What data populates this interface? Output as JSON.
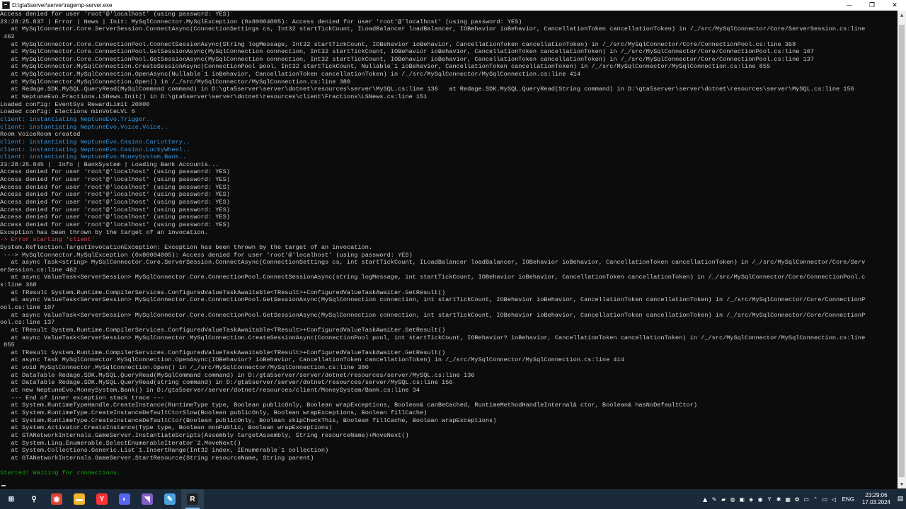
{
  "window": {
    "title": "D:\\gta5server\\server\\ragemp-server.exe",
    "minimize_label": "—",
    "maximize_label": "❐",
    "close_label": "✕"
  },
  "console": {
    "lines": [
      {
        "t": "Access denied for user 'root'@'localhost' (using password: YES)",
        "c": ""
      },
      {
        "t": "23:28:25.837 | Error | News | Init: MySqlConnector.MySqlException (0x80004005): Access denied for user 'root'@'localhost' (using password: YES)",
        "c": ""
      },
      {
        "t": "   at MySqlConnector.Core.ServerSession.ConnectAsync(ConnectionSettings cs, Int32 startTickCount, ILoadBalancer loadBalancer, IOBehavior ioBehavior, CancellationToken cancellationToken) in /_/src/MySqlConnector/Core/ServerSession.cs:line",
        "c": ""
      },
      {
        "t": " 462",
        "c": ""
      },
      {
        "t": "   at MySqlConnector.Core.ConnectionPool.ConnectSessionAsync(String logMessage, Int32 startTickCount, IOBehavior ioBehavior, CancellationToken cancellationToken) in /_/src/MySqlConnector/Core/ConnectionPool.cs:line 368",
        "c": ""
      },
      {
        "t": "   at MySqlConnector.Core.ConnectionPool.GetSessionAsync(MySqlConnection connection, Int32 startTickCount, IOBehavior ioBehavior, CancellationToken cancellationToken) in /_/src/MySqlConnector/Core/ConnectionPool.cs:line 107",
        "c": ""
      },
      {
        "t": "   at MySqlConnector.Core.ConnectionPool.GetSessionAsync(MySqlConnection connection, Int32 startTickCount, IOBehavior ioBehavior, CancellationToken cancellationToken) in /_/src/MySqlConnector/Core/ConnectionPool.cs:line 137",
        "c": ""
      },
      {
        "t": "   at MySqlConnector.MySqlConnection.CreateSessionAsync(ConnectionPool pool, Int32 startTickCount, Nullable`1 ioBehavior, CancellationToken cancellationToken) in /_/src/MySqlConnector/MySqlConnection.cs:line 855",
        "c": ""
      },
      {
        "t": "   at MySqlConnector.MySqlConnection.OpenAsync(Nullable`1 ioBehavior, CancellationToken cancellationToken) in /_/src/MySqlConnector/MySqlConnection.cs:line 414",
        "c": ""
      },
      {
        "t": "   at MySqlConnector.MySqlConnection.Open() in /_/src/MySqlConnector/MySqlConnection.cs:line 380",
        "c": ""
      },
      {
        "t": "   at Redage.SDK.MySQL.QueryRead(MySqlCommand command) in D:\\gta5server\\server\\dotnet\\resources\\server\\MySQL.cs:line 136   at Redage.SDK.MySQL.QueryRead(String command) in D:\\gta5server\\server\\dotnet\\resources\\server\\MySQL.cs:line 156",
        "c": ""
      },
      {
        "t": "   at NeptuneEvo.Fractions.LSNews.Init() in D:\\gta5server\\server\\dotnet\\resources\\client\\Fractions\\LSNews.cs:line 151",
        "c": ""
      },
      {
        "t": "Loaded config: EventSys RewardLimit 20000",
        "c": ""
      },
      {
        "t": "Loaded config: Elections minVoteLVL 5",
        "c": ""
      },
      {
        "t": "client: instantiating NeptuneEvo.Trigger..",
        "c": "cyan"
      },
      {
        "t": "client: instantiating NeptuneEvo.Voice.Voice..",
        "c": "cyan"
      },
      {
        "t": "Room VoiceRoom created",
        "c": ""
      },
      {
        "t": "client: instantiating NeptuneEvo.Casino.CarLottery..",
        "c": "cyan"
      },
      {
        "t": "client: instantiating NeptuneEvo.Casino.LuckyWheel..",
        "c": "cyan"
      },
      {
        "t": "client: instantiating NeptuneEvo.MoneySystem.Bank..",
        "c": "cyan"
      },
      {
        "t": "23:28:25.845 |  Info | BankSystem | Loading Bank Accounts...",
        "c": ""
      },
      {
        "t": "Access denied for user 'root'@'localhost' (using password: YES)",
        "c": ""
      },
      {
        "t": "Access denied for user 'root'@'localhost' (using password: YES)",
        "c": ""
      },
      {
        "t": "Access denied for user 'root'@'localhost' (using password: YES)",
        "c": ""
      },
      {
        "t": "Access denied for user 'root'@'localhost' (using password: YES)",
        "c": ""
      },
      {
        "t": "Access denied for user 'root'@'localhost' (using password: YES)",
        "c": ""
      },
      {
        "t": "Access denied for user 'root'@'localhost' (using password: YES)",
        "c": ""
      },
      {
        "t": "Access denied for user 'root'@'localhost' (using password: YES)",
        "c": ""
      },
      {
        "t": "Access denied for user 'root'@'localhost' (using password: YES)",
        "c": ""
      },
      {
        "t": "Exception has been thrown by the target of an invocation.",
        "c": ""
      },
      {
        "t": "-> Error starting 'client'",
        "c": "red"
      },
      {
        "t": "System.Reflection.TargetInvocationException: Exception has been thrown by the target of an invocation.",
        "c": ""
      },
      {
        "t": " ---> MySqlConnector.MySqlException (0x80004005): Access denied for user 'root'@'localhost' (using password: YES)",
        "c": ""
      },
      {
        "t": "   at async Task<string> MySqlConnector.Core.ServerSession.ConnectAsync(ConnectionSettings cs, int startTickCount, ILoadBalancer loadBalancer, IOBehavior ioBehavior, CancellationToken cancellationToken) in /_/src/MySqlConnector/Core/Serv",
        "c": ""
      },
      {
        "t": "erSession.cs:line 462",
        "c": ""
      },
      {
        "t": "   at async ValueTask<ServerSession> MySqlConnector.Core.ConnectionPool.ConnectSessionAsync(string logMessage, int startTickCount, IOBehavior ioBehavior, CancellationToken cancellationToken) in /_/src/MySqlConnector/Core/ConnectionPool.c",
        "c": ""
      },
      {
        "t": "s:line 368",
        "c": ""
      },
      {
        "t": "   at TResult System.Runtime.CompilerServices.ConfiguredValueTaskAwaitable<TResult>+ConfiguredValueTaskAwaiter.GetResult()",
        "c": ""
      },
      {
        "t": "   at async ValueTask<ServerSession> MySqlConnector.Core.ConnectionPool.GetSessionAsync(MySqlConnection connection, int startTickCount, IOBehavior ioBehavior, CancellationToken cancellationToken) in /_/src/MySqlConnector/Core/ConnectionP",
        "c": ""
      },
      {
        "t": "ool.cs:line 107",
        "c": ""
      },
      {
        "t": "   at async ValueTask<ServerSession> MySqlConnector.Core.ConnectionPool.GetSessionAsync(MySqlConnection connection, int startTickCount, IOBehavior ioBehavior, CancellationToken cancellationToken) in /_/src/MySqlConnector/Core/ConnectionP",
        "c": ""
      },
      {
        "t": "ool.cs:line 137",
        "c": ""
      },
      {
        "t": "   at TResult System.Runtime.CompilerServices.ConfiguredValueTaskAwaitable<TResult>+ConfiguredValueTaskAwaiter.GetResult()",
        "c": ""
      },
      {
        "t": "   at async ValueTask<ServerSession> MySqlConnector.MySqlConnection.CreateSessionAsync(ConnectionPool pool, int startTickCount, IOBehavior? ioBehavior, CancellationToken cancellationToken) in /_/src/MySqlConnector/MySqlConnection.cs:line",
        "c": ""
      },
      {
        "t": " 855",
        "c": ""
      },
      {
        "t": "   at TResult System.Runtime.CompilerServices.ConfiguredValueTaskAwaitable<TResult>+ConfiguredValueTaskAwaiter.GetResult()",
        "c": ""
      },
      {
        "t": "   at async Task MySqlConnector.MySqlConnection.OpenAsync(IOBehavior? ioBehavior, CancellationToken cancellationToken) in /_/src/MySqlConnector/MySqlConnection.cs:line 414",
        "c": ""
      },
      {
        "t": "   at void MySqlConnector.MySqlConnection.Open() in /_/src/MySqlConnector/MySqlConnection.cs:line 380",
        "c": ""
      },
      {
        "t": "   at DataTable Redage.SDK.MySQL.QueryRead(MySqlCommand command) in D:/gta5server/server/dotnet/resources/server/MySQL.cs:line 136",
        "c": ""
      },
      {
        "t": "   at DataTable Redage.SDK.MySQL.QueryRead(string command) in D:/gta5server/server/dotnet/resources/server/MySQL.cs:line 156",
        "c": ""
      },
      {
        "t": "   at new NeptuneEvo.MoneySystem.Bank() in D:/gta5server/server/dotnet/resources/client/MoneySystem/Bank.cs:line 34",
        "c": ""
      },
      {
        "t": "   --- End of inner exception stack trace ---",
        "c": ""
      },
      {
        "t": "   at System.RuntimeTypeHandle.CreateInstance(RuntimeType type, Boolean publicOnly, Boolean wrapExceptions, Boolean& canBeCached, RuntimeMethodHandleInternal& ctor, Boolean& hasNoDefaultCtor)",
        "c": ""
      },
      {
        "t": "   at System.RuntimeType.CreateInstanceDefaultCtorSlow(Boolean publicOnly, Boolean wrapExceptions, Boolean fillCache)",
        "c": ""
      },
      {
        "t": "   at System.RuntimeType.CreateInstanceDefaultCtor(Boolean publicOnly, Boolean skipCheckThis, Boolean fillCache, Boolean wrapExceptions)",
        "c": ""
      },
      {
        "t": "   at System.Activator.CreateInstance(Type type, Boolean nonPublic, Boolean wrapExceptions)",
        "c": ""
      },
      {
        "t": "   at GTANetworkInternals.GameServer.InstantiateScripts(Assembly targetAssembly, String resourceName)+MoveNext()",
        "c": ""
      },
      {
        "t": "   at System.Linq.Enumerable.SelectEnumerableIterator`2.MoveNext()",
        "c": ""
      },
      {
        "t": "   at System.Collections.Generic.List`1.InsertRange(Int32 index, IEnumerable`1 collection)",
        "c": ""
      },
      {
        "t": "   at GTANetworkInternals.GameServer.StartResource(String resourceName, String parent)",
        "c": ""
      },
      {
        "t": "",
        "c": ""
      },
      {
        "t": "Started! Waiting for connections..",
        "c": "green"
      }
    ]
  },
  "taskbar": {
    "icons": [
      {
        "name": "start-icon",
        "glyph": "⊞",
        "bg": "",
        "active": false
      },
      {
        "name": "search-icon",
        "glyph": "⚲",
        "bg": "",
        "active": false
      },
      {
        "name": "chrome-icon",
        "glyph": "◉",
        "bg": "#db4437",
        "active": false
      },
      {
        "name": "file-explorer-icon",
        "glyph": "▬",
        "bg": "#f0b429",
        "active": false
      },
      {
        "name": "yandex-browser-icon",
        "glyph": "Y",
        "bg": "#ff3333",
        "active": false
      },
      {
        "name": "discord-icon",
        "glyph": "◐",
        "bg": "#5865f2",
        "active": false
      },
      {
        "name": "visual-studio-icon",
        "glyph": "◥",
        "bg": "#865fc5",
        "active": false
      },
      {
        "name": "notepad-icon",
        "glyph": "✎",
        "bg": "#4aa3df",
        "active": false
      },
      {
        "name": "ragemp-server-icon",
        "glyph": "R",
        "bg": "#222222",
        "active": true
      }
    ],
    "tray_icons": [
      {
        "name": "tray-app-1-icon",
        "glyph": "▲"
      },
      {
        "name": "tray-app-2-icon",
        "glyph": "✎"
      },
      {
        "name": "tray-app-3-icon",
        "glyph": "▰"
      },
      {
        "name": "tray-app-4-icon",
        "glyph": "◍"
      },
      {
        "name": "tray-app-5-icon",
        "glyph": "▣"
      },
      {
        "name": "tray-app-6-icon",
        "glyph": "◈"
      },
      {
        "name": "tray-app-7-icon",
        "glyph": "◉"
      },
      {
        "name": "tray-app-8-icon",
        "glyph": "Y"
      },
      {
        "name": "tray-app-9-icon",
        "glyph": "✱"
      },
      {
        "name": "tray-app-10-icon",
        "glyph": "▦"
      },
      {
        "name": "tray-app-11-icon",
        "glyph": "✿"
      },
      {
        "name": "tray-app-12-icon",
        "glyph": "▭"
      },
      {
        "name": "tray-app-13-icon",
        "glyph": "⌃"
      },
      {
        "name": "network-icon",
        "glyph": "▭"
      },
      {
        "name": "volume-icon",
        "glyph": "◁"
      }
    ],
    "language": "ENG",
    "time": "23:29:06",
    "date": "17.03.2024",
    "notification_glyph": "▤"
  }
}
